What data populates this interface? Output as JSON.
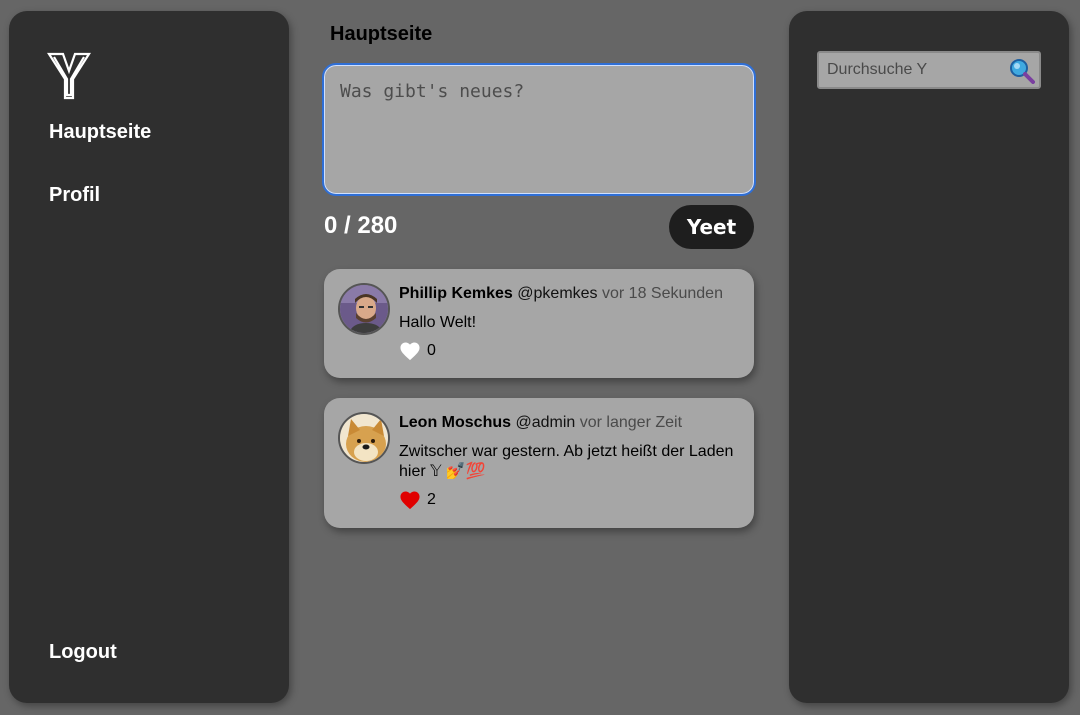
{
  "sidebar": {
    "logo": "Y",
    "items": [
      {
        "label": "Hauptseite"
      },
      {
        "label": "Profil"
      }
    ],
    "logout_label": "Logout"
  },
  "main": {
    "title": "Hauptseite",
    "composer_placeholder": "Was gibt's neues?",
    "counter": "0 / 280",
    "submit_label": "Yeet",
    "posts": [
      {
        "author": "Phillip Kemkes",
        "handle": "@pkemkes",
        "time": "vor 18 Sekunden",
        "text": "Hallo Welt!",
        "liked": false,
        "likes": "0",
        "avatar": "person-avatar"
      },
      {
        "author": "Leon Moschus",
        "handle": "@admin",
        "time": "vor langer Zeit",
        "text": "Zwitscher war gestern. Ab jetzt heißt der Laden hier 𝕐 💅💯",
        "liked": true,
        "likes": "2",
        "avatar": "doge-avatar"
      }
    ]
  },
  "search": {
    "placeholder": "Durchsuche Y",
    "icon": "magnifier-icon"
  },
  "colors": {
    "background": "#666666",
    "panel": "#2f2f2f",
    "card": "#a6a6a6",
    "accent_border": "#2f6fd6",
    "heart_liked": "#e00000"
  }
}
